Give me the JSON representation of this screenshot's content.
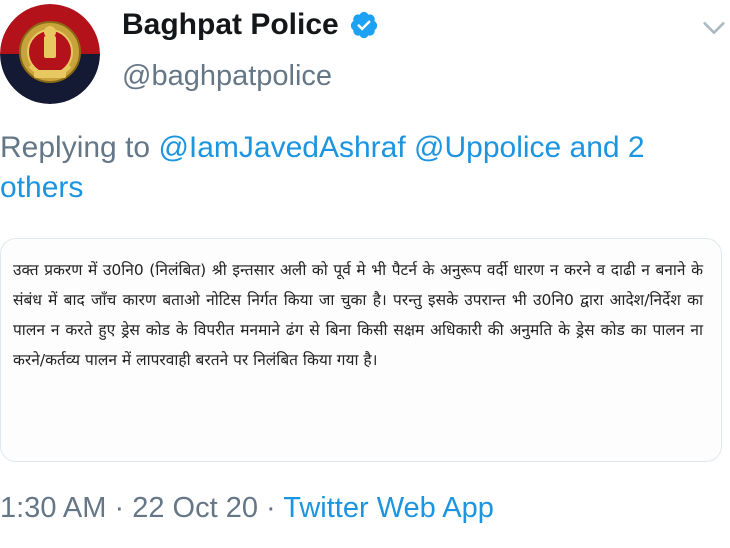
{
  "tweet": {
    "author": {
      "display_name": "Baghpat Police",
      "handle": "@baghpatpolice",
      "verified": true,
      "avatar_icon": "up-police-emblem-icon"
    },
    "reply": {
      "prefix": "Replying to",
      "mentions": [
        "@IamJavedAshraf",
        "@Uppolice"
      ],
      "and_others": "and 2 others"
    },
    "media": {
      "text": "उक्त प्रकरण में उ0नि0 (निलंबित) श्री इन्तसार अली को पूर्व मे भी पैटर्न के अनुरूप वर्दी धारण न करने व दाढी न बनाने के संबंध में बाद जाँच कारण बताओ नोटिस निर्गत किया जा चुका है। परन्तु इसके उपरान्त भी उ0नि0 द्वारा आदेश/निर्देश का पालन न करते हुए ड्रेस कोड के विपरीत मनमाने ढंग से बिना किसी सक्षम अधिकारी की अनुमति के ड्रेस कोड का पालन ना करने/कर्तव्य पालन में लापरवाही बरतने पर निलंबित किया गया है।"
    },
    "meta": {
      "time": "1:30 AM",
      "separator": "·",
      "date": "22 Oct 20",
      "source": "Twitter Web App"
    }
  },
  "colors": {
    "link": "#1b95e0",
    "secondary_text": "#657786",
    "primary_text": "#14171a",
    "verified_badge": "#1da1f2"
  }
}
